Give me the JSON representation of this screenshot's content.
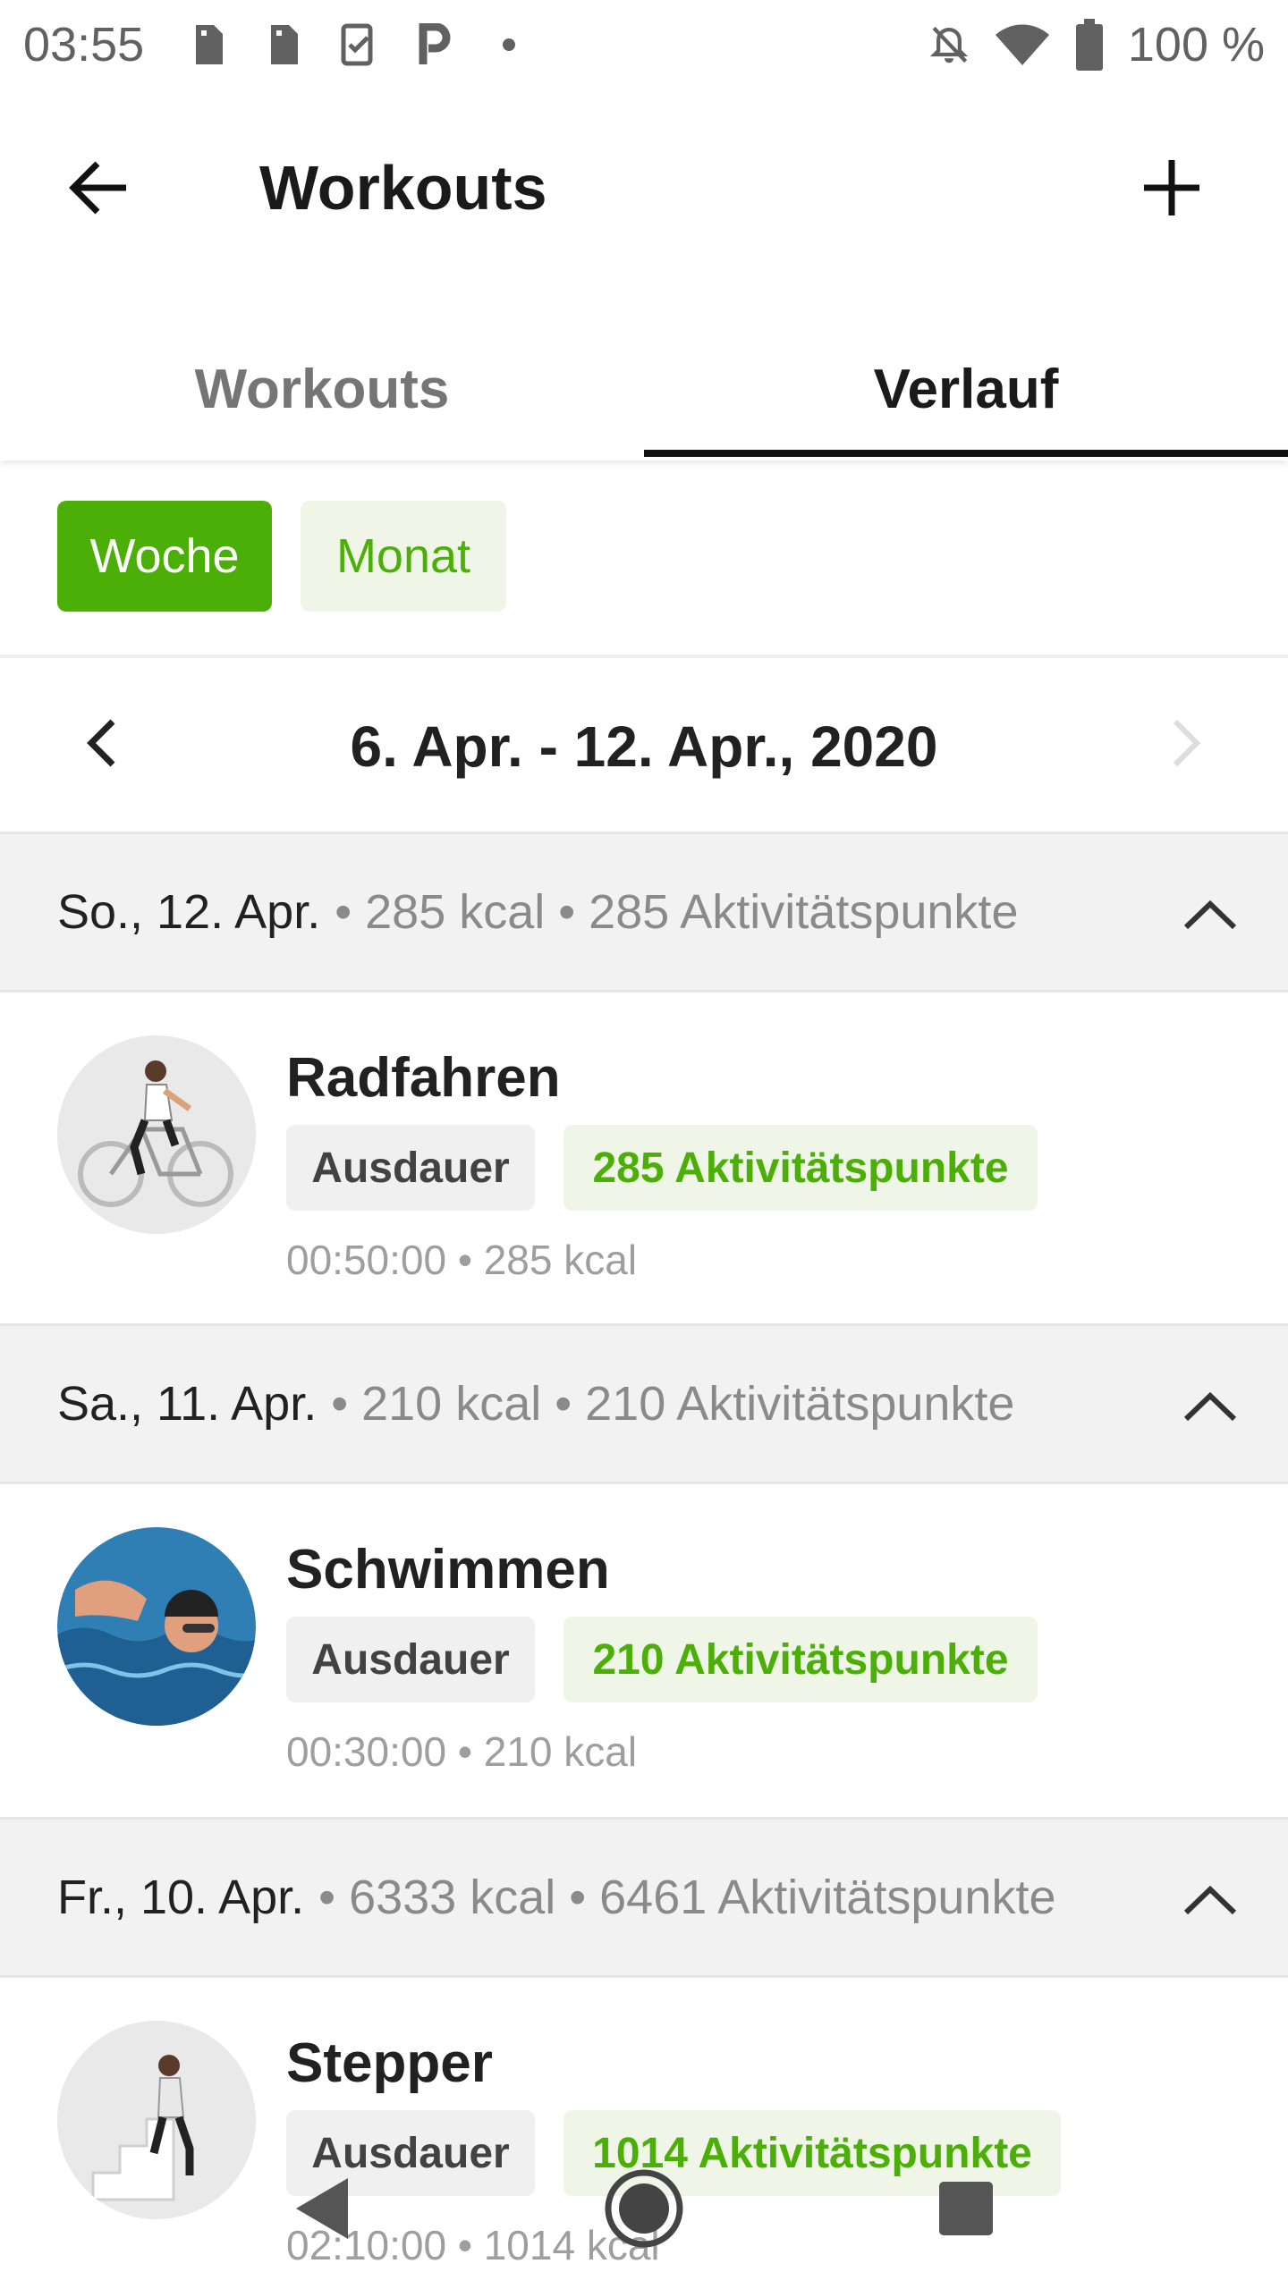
{
  "status_bar": {
    "time": "03:55",
    "battery": "100 %",
    "icons": [
      "sim-icon",
      "sim-icon",
      "checklist-icon",
      "parking-icon",
      "dot-icon",
      "notifications-off-icon",
      "wifi-icon",
      "battery-icon"
    ]
  },
  "app_bar": {
    "title": "Workouts",
    "back_icon": "arrow-back-icon",
    "add_icon": "plus-icon"
  },
  "tabs": [
    {
      "label": "Workouts",
      "active": false
    },
    {
      "label": "Verlauf",
      "active": true
    }
  ],
  "filters": {
    "week": "Woche",
    "month": "Monat",
    "selected": "Woche"
  },
  "date_range": {
    "label": "6. Apr. - 12. Apr., 2020"
  },
  "days": [
    {
      "date": "So., 12. Apr.",
      "meta": "• 285 kcal • 285 Aktivitätspunkte",
      "workout": {
        "name": "Radfahren",
        "type": "Ausdauer",
        "points": "285 Aktivitätspunkte",
        "meta": "00:50:00 • 285 kcal",
        "avatar": "cyclist-icon"
      }
    },
    {
      "date": "Sa., 11. Apr.",
      "meta": "• 210 kcal • 210 Aktivitätspunkte",
      "workout": {
        "name": "Schwimmen",
        "type": "Ausdauer",
        "points": "210 Aktivitätspunkte",
        "meta": "00:30:00 • 210 kcal",
        "avatar": "swimmer-icon"
      }
    },
    {
      "date": "Fr., 10. Apr.",
      "meta": "• 6333 kcal • 6461 Aktivitätspunkte",
      "workout": {
        "name": "Stepper",
        "type": "Ausdauer",
        "points": "1014 Aktivitätspunkte",
        "meta": "02:10:00 • 1014 kcal",
        "avatar": "stepper-icon"
      }
    }
  ],
  "colors": {
    "accent": "#4caf08",
    "accent_light": "#eff6e8",
    "header_bg": "#f2f2f2"
  }
}
